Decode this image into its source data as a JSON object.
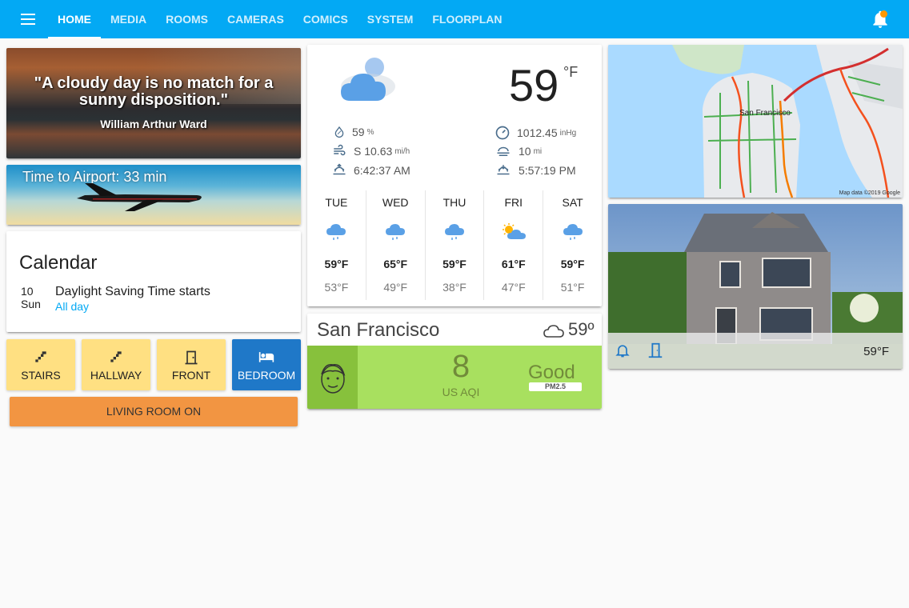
{
  "header": {
    "tabs": [
      {
        "label": "HOME"
      },
      {
        "label": "MEDIA"
      },
      {
        "label": "ROOMS"
      },
      {
        "label": "CAMERAS"
      },
      {
        "label": "COMICS"
      },
      {
        "label": "SYSTEM"
      },
      {
        "label": "FLOORPLAN"
      }
    ],
    "accent_color": "#03a9f4"
  },
  "quote": {
    "text": "\"A cloudy day is no match for a sunny disposition.\"",
    "author": "William Arthur Ward"
  },
  "airport": {
    "text": "Time to Airport: 33 min"
  },
  "calendar": {
    "title": "Calendar",
    "day_number": "10",
    "day_name": "Sun",
    "event": "Daylight Saving Time starts",
    "time": "All day"
  },
  "buttons": [
    {
      "label": "STAIRS",
      "icon": "stairs-icon",
      "state": "off"
    },
    {
      "label": "HALLWAY",
      "icon": "stairs-icon",
      "state": "off"
    },
    {
      "label": "FRONT",
      "icon": "door-icon",
      "state": "off"
    },
    {
      "label": "BEDROOM",
      "icon": "bed-icon",
      "state": "on"
    }
  ],
  "living_room": {
    "label": "LIVING ROOM ON"
  },
  "weather": {
    "temperature": "59",
    "unit": "°F",
    "humidity": "59",
    "humidity_unit": "%",
    "wind": "S 10.63",
    "wind_unit": "mi/h",
    "sunrise": "6:42:37 AM",
    "pressure": "1012.45",
    "pressure_unit": "inHg",
    "visibility": "10",
    "visibility_unit": "mi",
    "sunset": "5:57:19 PM",
    "forecast": [
      {
        "day": "TUE",
        "hi": "59°F",
        "lo": "53°F",
        "icon": "rain-cloud-icon"
      },
      {
        "day": "WED",
        "hi": "65°F",
        "lo": "49°F",
        "icon": "rain-cloud-icon"
      },
      {
        "day": "THU",
        "hi": "59°F",
        "lo": "38°F",
        "icon": "rain-cloud-icon"
      },
      {
        "day": "FRI",
        "hi": "61°F",
        "lo": "47°F",
        "icon": "partly-sunny-icon"
      },
      {
        "day": "SAT",
        "hi": "59°F",
        "lo": "51°F",
        "icon": "rain-cloud-icon"
      }
    ]
  },
  "aqi": {
    "city": "San Francisco",
    "weather_temp": "59º",
    "value": "8",
    "unit": "US AQI",
    "label": "Good",
    "pollutant": "PM2.5",
    "color": "#a8e05f"
  },
  "map": {
    "city_label": "San Francisco",
    "credit": "Map data ©2019 Google"
  },
  "house": {
    "temperature": "59°F"
  }
}
